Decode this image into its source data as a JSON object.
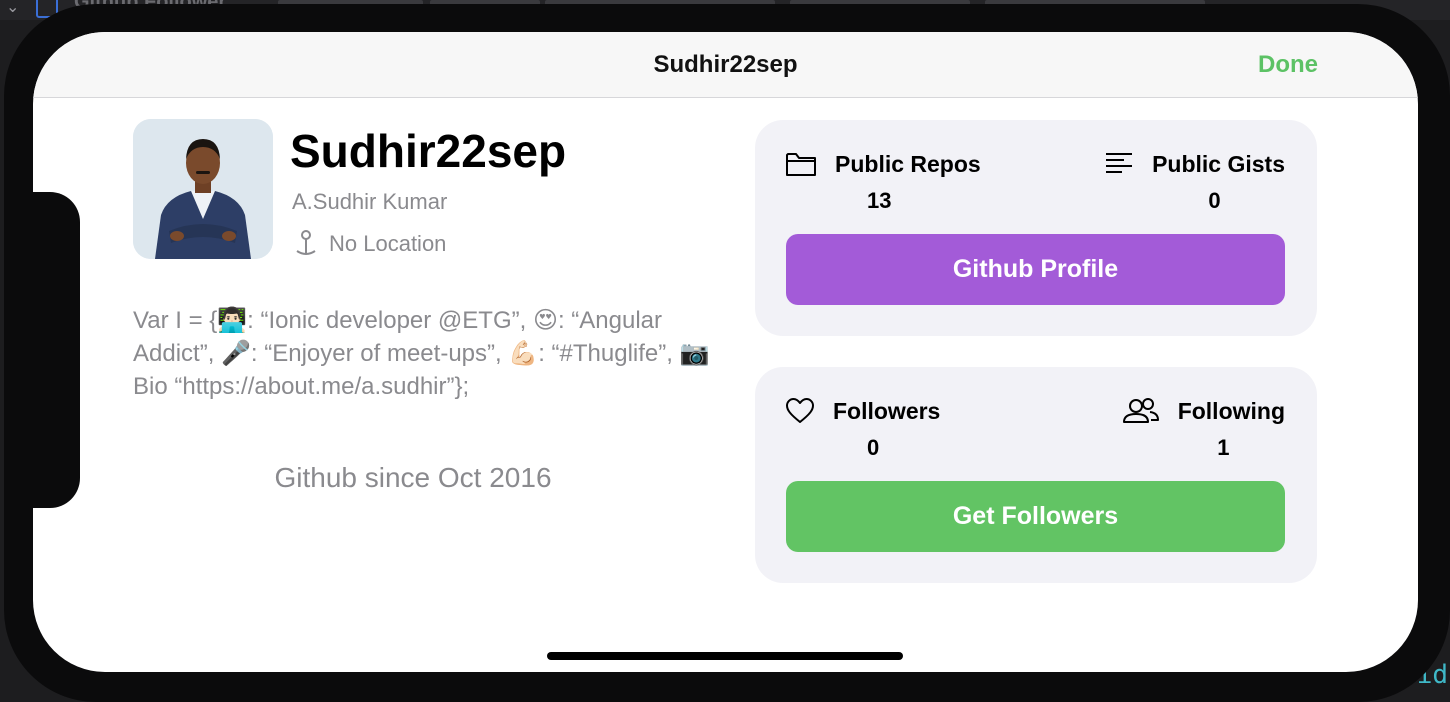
{
  "background": {
    "title_partial": "Github Follower",
    "code_fragment": "id"
  },
  "nav": {
    "title": "Sudhir22sep",
    "done_label": "Done"
  },
  "profile": {
    "username": "Sudhir22sep",
    "full_name": "A.Sudhir Kumar",
    "location": "No Location",
    "bio": "Var I = {👨🏻‍💻: “Ionic developer @ETG”, 😍: “Angular Addict”, 🎤: “Enjoyer of meet-ups”, 💪🏻: “#Thuglife”, 📷Bio “https://about.me/a.sudhir”};",
    "github_since": "Github since Oct 2016"
  },
  "repos_card": {
    "left_label": "Public Repos",
    "left_value": "13",
    "left_icon": "folder-icon",
    "right_label": "Public Gists",
    "right_value": "0",
    "right_icon": "text-align-left-icon",
    "button_label": "Github Profile",
    "button_color": "#a35bd8"
  },
  "followers_card": {
    "left_label": "Followers",
    "left_value": "0",
    "left_icon": "heart-icon",
    "right_label": "Following",
    "right_value": "1",
    "right_icon": "person-2-icon",
    "button_label": "Get Followers",
    "button_color": "#62c464"
  },
  "colors": {
    "accent_green": "#5cc265",
    "secondary_text": "#8a8a8e",
    "card_bg": "#f2f2f7"
  }
}
